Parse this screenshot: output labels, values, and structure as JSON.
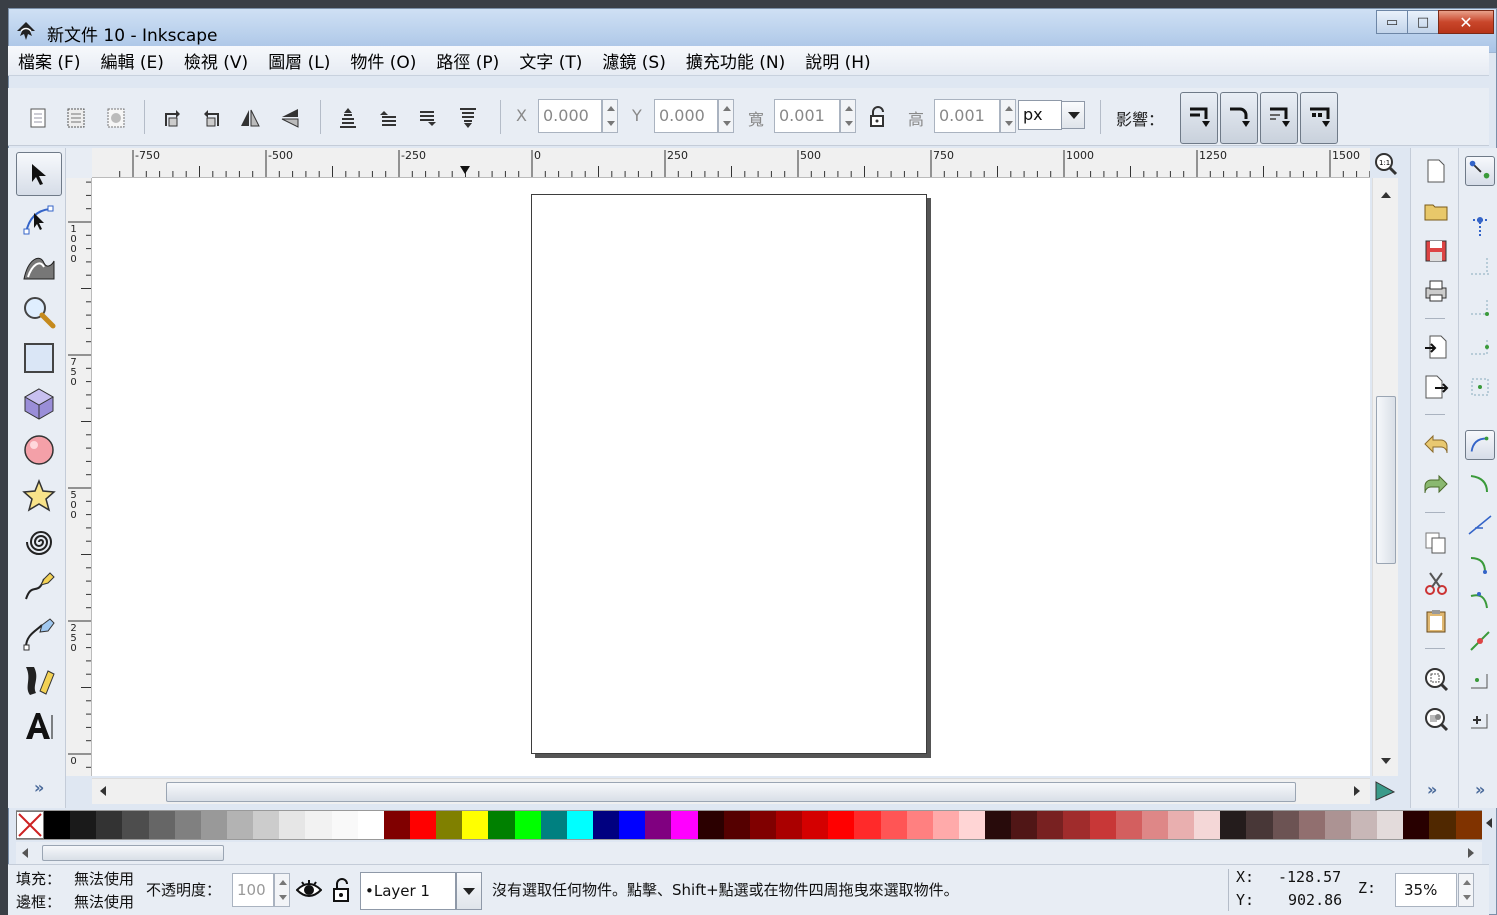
{
  "window": {
    "title": "新文件 10 - Inkscape",
    "minimize": "▭",
    "maximize": "□",
    "close": "✕"
  },
  "menu": [
    {
      "label": "檔案 (F)"
    },
    {
      "label": "編輯 (E)"
    },
    {
      "label": "檢視 (V)"
    },
    {
      "label": "圖層 (L)"
    },
    {
      "label": "物件 (O)"
    },
    {
      "label": "路徑 (P)"
    },
    {
      "label": "文字 (T)"
    },
    {
      "label": "濾鏡 (S)"
    },
    {
      "label": "擴充功能 (N)"
    },
    {
      "label": "說明 (H)"
    }
  ],
  "toolbar": {
    "x_label": "X",
    "x_value": "0.000",
    "y_label": "Y",
    "y_value": "0.000",
    "w_label": "寬",
    "w_value": "0.001",
    "h_label": "高",
    "h_value": "0.001",
    "unit": "px",
    "affect_label": "影響："
  },
  "ruler_h": [
    "-750",
    "-500",
    "-250",
    "0",
    "250",
    "500",
    "750",
    "1000",
    "1250",
    "1500"
  ],
  "ruler_v": [
    "1000",
    "750",
    "500",
    "250",
    "0"
  ],
  "tools": [
    "selector-tool",
    "node-tool",
    "tweak-tool",
    "zoom-tool",
    "rectangle-tool",
    "3dbox-tool",
    "circle-tool",
    "star-tool",
    "spiral-tool",
    "pencil-tool",
    "pen-tool",
    "calligraphy-tool",
    "text-tool"
  ],
  "palette": [
    "#000000",
    "#1a1a1a",
    "#333333",
    "#4d4d4d",
    "#666666",
    "#808080",
    "#999999",
    "#b3b3b3",
    "#cccccc",
    "#e6e6e6",
    "#f2f2f2",
    "#f9f9f9",
    "#ffffff",
    "#800000",
    "#ff0000",
    "#808000",
    "#ffff00",
    "#008000",
    "#00ff00",
    "#008080",
    "#00ffff",
    "#000080",
    "#0000ff",
    "#800080",
    "#ff00ff",
    "#2b0000",
    "#550000",
    "#800000",
    "#aa0000",
    "#d40000",
    "#ff0000",
    "#ff2a2a",
    "#ff5555",
    "#ff8080",
    "#ffaaaa",
    "#ffd5d5",
    "#280b0b",
    "#501616",
    "#782121",
    "#a02c2c",
    "#c83737",
    "#d35f5f",
    "#de8787",
    "#e9afaf",
    "#f4d7d7",
    "#241c1c",
    "#483737",
    "#6c5353",
    "#916f6f",
    "#ac9393",
    "#c8b7b7",
    "#e3dbdb",
    "#280000",
    "#502800",
    "#803300"
  ],
  "status": {
    "fill_label": "填充：",
    "fill_value": "無法使用",
    "stroke_label": "邊框：",
    "stroke_value": "無法使用",
    "opacity_label": "不透明度：",
    "opacity_value": "100",
    "layer": "•Layer 1",
    "message": "沒有選取任何物件。點擊、Shift+點選或在物件四周拖曳來選取物件。",
    "x_label": "X:",
    "x_value": "-128.57",
    "y_label": "Y:",
    "y_value": "902.86",
    "z_label": "Z:",
    "zoom": "35%"
  },
  "colors": {
    "accent": "#4a6a9a",
    "close_red": "#c9462b"
  }
}
